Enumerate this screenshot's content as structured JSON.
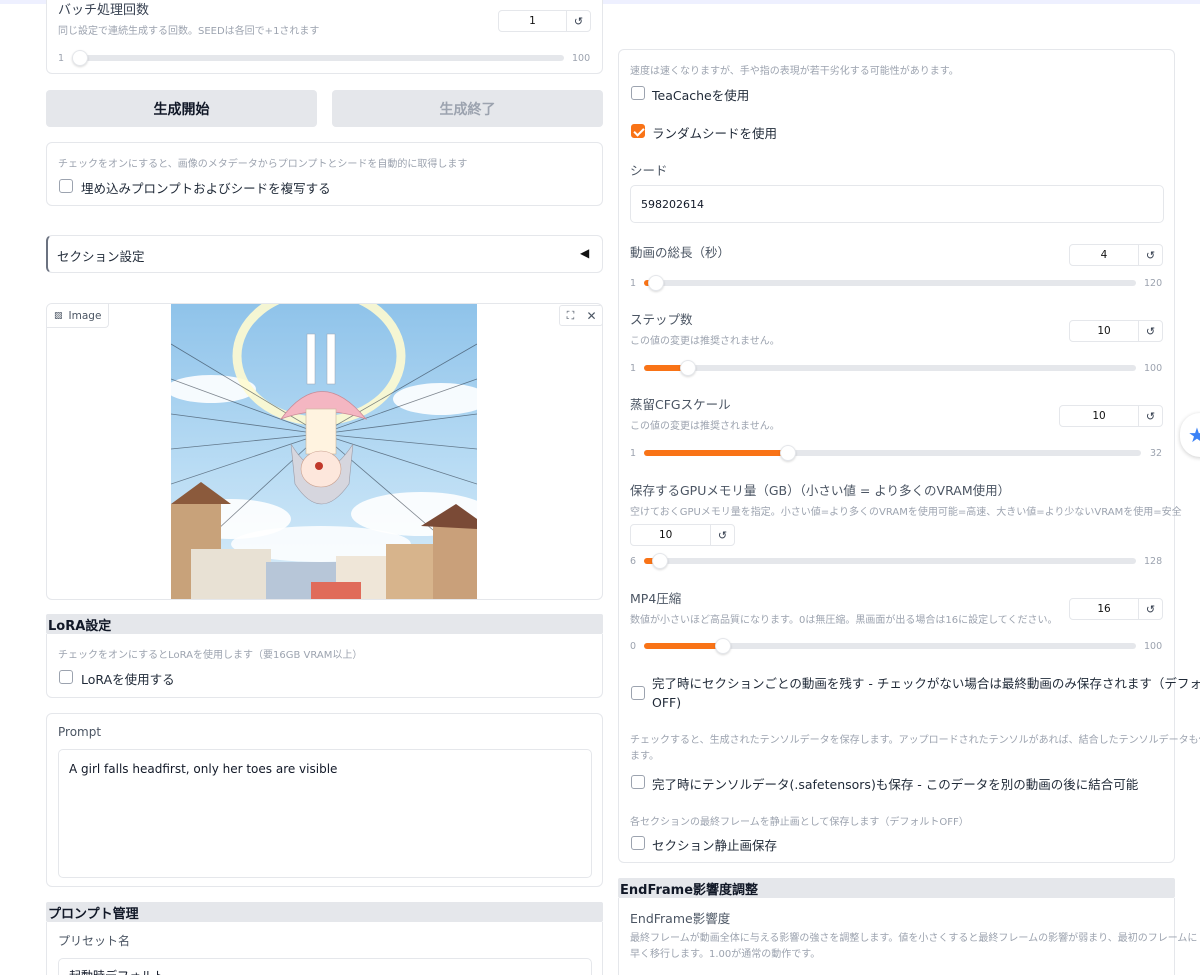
{
  "left": {
    "batch": {
      "title": "バッチ処理回数",
      "hint": "同じ設定で連続生成する回数。SEEDは各回で+1されます",
      "value": "1",
      "min": "1",
      "max": "100",
      "fraction": 0.0
    },
    "start_button": "生成開始",
    "stop_button": "生成終了",
    "metadata": {
      "hint": "チェックをオンにすると、画像のメタデータからプロンプトとシードを自動的に取得します",
      "label": "埋め込みプロンプトおよびシードを複写する",
      "checked": false
    },
    "section_settings": "セクション設定",
    "image": {
      "label": "Image"
    },
    "lora": {
      "title": "LoRA設定",
      "hint": "チェックをオンにするとLoRAを使用します（要16GB VRAM以上）",
      "label": "LoRAを使用する",
      "checked": false
    },
    "prompt": {
      "label": "Prompt",
      "value": "A girl falls headfirst, only her toes are visible"
    },
    "prompt_mgmt": {
      "title": "プロンプト管理",
      "preset_label": "プリセット名",
      "preset_value": "起動時デフォルト"
    }
  },
  "right": {
    "teacache": {
      "hint": "速度は速くなりますが、手や指の表現が若干劣化する可能性があります。",
      "label": "TeaCacheを使用",
      "checked": false
    },
    "random_seed": {
      "label": "ランダムシードを使用",
      "checked": true
    },
    "seed": {
      "label": "シード",
      "value": "598202614"
    },
    "duration": {
      "label": "動画の総長（秒）",
      "value": "4",
      "min": "1",
      "max": "120",
      "fraction": 0.025
    },
    "steps": {
      "label": "ステップ数",
      "hint": "この値の変更は推奨されません。",
      "value": "10",
      "min": "1",
      "max": "100",
      "fraction": 0.09
    },
    "cfg": {
      "label": "蒸留CFGスケール",
      "hint": "この値の変更は推奨されません。",
      "value": "10",
      "min": "1",
      "max": "32",
      "fraction": 0.29
    },
    "gpu": {
      "label": "保存するGPUメモリ量（GB）（小さい値 = より多くのVRAM使用）",
      "hint": "空けておくGPUメモリ量を指定。小さい値=より多くのVRAMを使用可能=高速、大きい値=より少ないVRAMを使用=安全",
      "value": "10",
      "min": "6",
      "max": "128",
      "fraction": 0.033
    },
    "mp4": {
      "label": "MP4圧縮",
      "hint": "数値が小さいほど高品質になります。0は無圧縮。黒画面が出る場合は16に設定してください。",
      "value": "16",
      "min": "0",
      "max": "100",
      "fraction": 0.16
    },
    "keep_sections": {
      "label_line1": "完了時にセクションごとの動画を残す - チェックがない場合は最終動画のみ保存されます（デフォルト",
      "label_line2": "OFF)",
      "checked": false
    },
    "tensor": {
      "hint_line1": "チェックすると、生成されたテンソルデータを保存します。アップロードされたテンソルがあれば、結合したテンソルデータも保存され",
      "hint_line2": "ます。",
      "label": "完了時にテンソルデータ(.safetensors)も保存 - このデータを別の動画の後に結合可能",
      "checked": false
    },
    "section_still": {
      "hint": "各セクションの最終フレームを静止画として保存します（デフォルトOFF）",
      "label": "セクション静止画保存",
      "checked": false
    },
    "endframe": {
      "title": "EndFrame影響度調整",
      "label": "EndFrame影響度",
      "hint_line1": "最終フレームが動画全体に与える影響の強さを調整します。値を小さくすると最終フレームの影響が弱まり、最初のフレームに",
      "hint_line2": "早く移行します。1.00が通常の動作です。"
    }
  },
  "colors": {
    "accent": "#f97316",
    "border": "#e5e7eb",
    "header_bg": "#e5e7eb"
  }
}
